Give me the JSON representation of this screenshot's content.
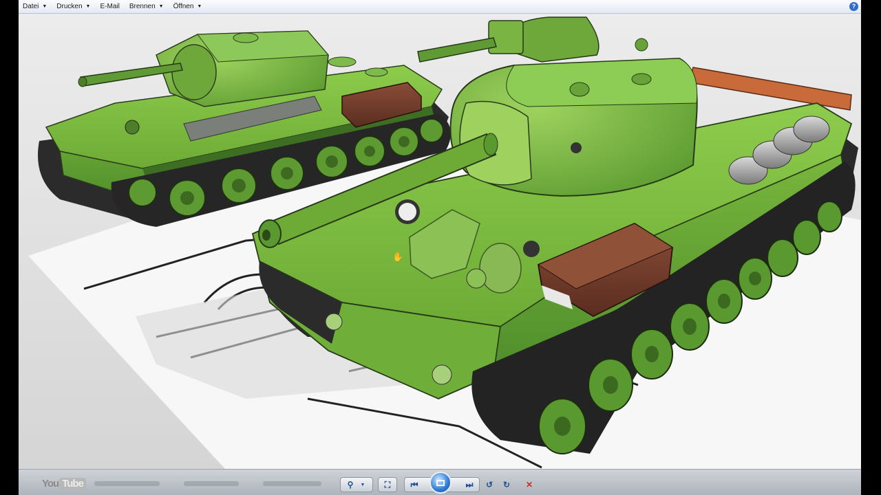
{
  "menu": {
    "items": [
      {
        "label": "Datei",
        "has_dropdown": true
      },
      {
        "label": "Drucken",
        "has_dropdown": true
      },
      {
        "label": "E-Mail",
        "has_dropdown": false
      },
      {
        "label": "Brennen",
        "has_dropdown": true
      },
      {
        "label": "Öffnen",
        "has_dropdown": true
      }
    ],
    "help_glyph": "?"
  },
  "toolbar": {
    "logo_text_a": "You",
    "logo_text_b": "Tube",
    "icons": [
      "zoom-icon",
      "fit-window-icon",
      "previous-icon",
      "slideshow-icon",
      "next-icon",
      "rotate-left-icon",
      "rotate-right-icon",
      "delete-icon"
    ]
  },
  "colors": {
    "tank_green": "#7fbf3f",
    "tank_dark": "#4e8a2a",
    "crate_brown": "#6e3a2a",
    "barrel_orange": "#c86a3a",
    "toolbar_accent": "#2d7ad6",
    "delete_red": "#d22828"
  }
}
